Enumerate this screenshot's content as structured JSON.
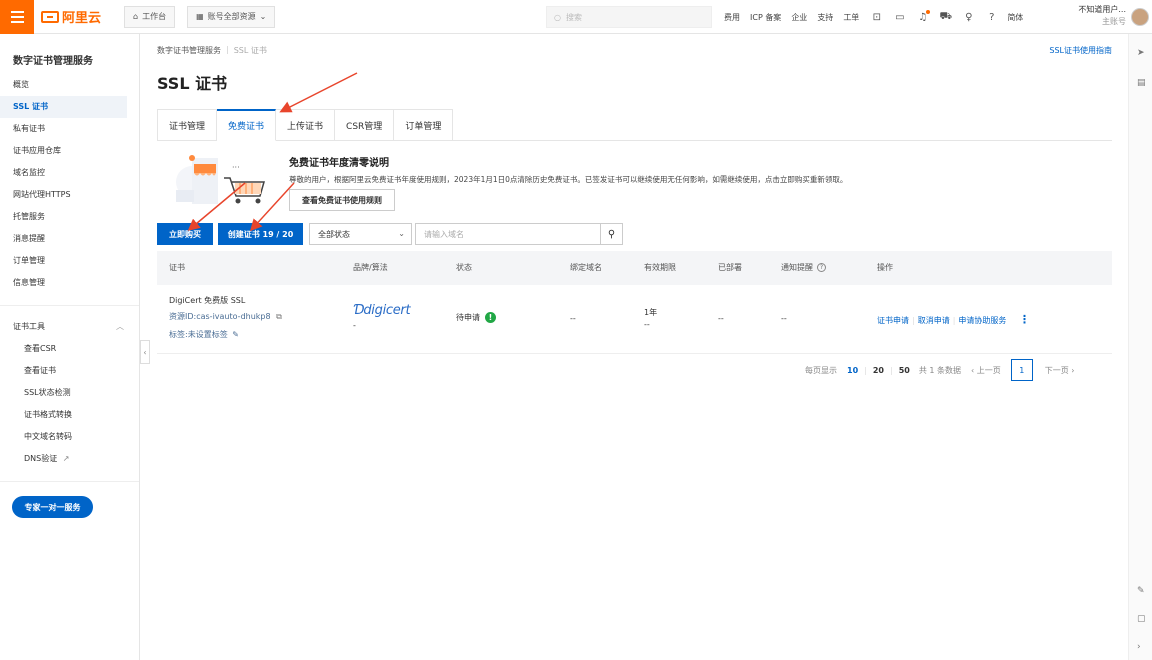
{
  "topbar": {
    "logo_text": "阿里云",
    "workbench": "工作台",
    "account_resources": "账号全部资源",
    "search_placeholder": "搜索",
    "links": [
      "费用",
      "ICP 备案",
      "企业",
      "支持",
      "工单"
    ],
    "lang": "简体",
    "user_name": "不知道用户...",
    "user_role": "主账号",
    "accent": "#ff6a00"
  },
  "sidebar": {
    "title": "数字证书管理服务",
    "items": [
      "概览",
      "SSL 证书",
      "私有证书",
      "证书应用仓库",
      "域名监控",
      "网站代理HTTPS",
      "托管服务",
      "消息提醒",
      "订单管理",
      "信息管理"
    ],
    "tools_title": "证书工具",
    "tools": [
      "查看CSR",
      "查看证书",
      "SSL状态检测",
      "证书格式转换",
      "中文域名转码",
      "DNS验证"
    ],
    "expert_button": "专家一对一服务"
  },
  "main": {
    "breadcrumb": [
      "数字证书管理服务",
      "SSL 证书"
    ],
    "guide_link": "SSL证书使用指南",
    "title": "SSL 证书",
    "tabs": [
      "证书管理",
      "免费证书",
      "上传证书",
      "CSR管理",
      "订单管理"
    ],
    "notice": {
      "title": "免费证书年度清零说明",
      "text": "尊敬的用户，根据阿里云免费证书年度使用规则，2023年1月1日0点清除历史免费证书。已签发证书可以继续使用无任何影响，如需继续使用，点击立即购买重新领取。",
      "button": "查看免费证书使用规则"
    },
    "toolbar": {
      "buy_button": "立即购买",
      "create_button": "创建证书 19 / 20",
      "status_select": "全部状态",
      "domain_placeholder": "请输入域名"
    },
    "table": {
      "headers": [
        "证书",
        "品牌/算法",
        "状态",
        "绑定域名",
        "有效期限",
        "已部署",
        "通知提醒",
        "操作"
      ],
      "rows": [
        {
          "name": "DigiCert 免费版 SSL",
          "resource_id": "资源ID:cas-ivauto-dhukp8",
          "tag": "标签:未设置标签",
          "brand": "digicert",
          "algo": "-",
          "status": "待申请",
          "domain": "--",
          "validity": "1年",
          "validity_sub": "--",
          "deployed": "--",
          "notify": "--",
          "ops": [
            "证书申请",
            "取消申请",
            "申请协助服务"
          ]
        }
      ]
    },
    "pager": {
      "page_size_label": "每页显示",
      "sizes": [
        "10",
        "20",
        "50"
      ],
      "total": "共 1 条数据",
      "prev": "上一页",
      "current": "1",
      "next": "下一页"
    }
  }
}
